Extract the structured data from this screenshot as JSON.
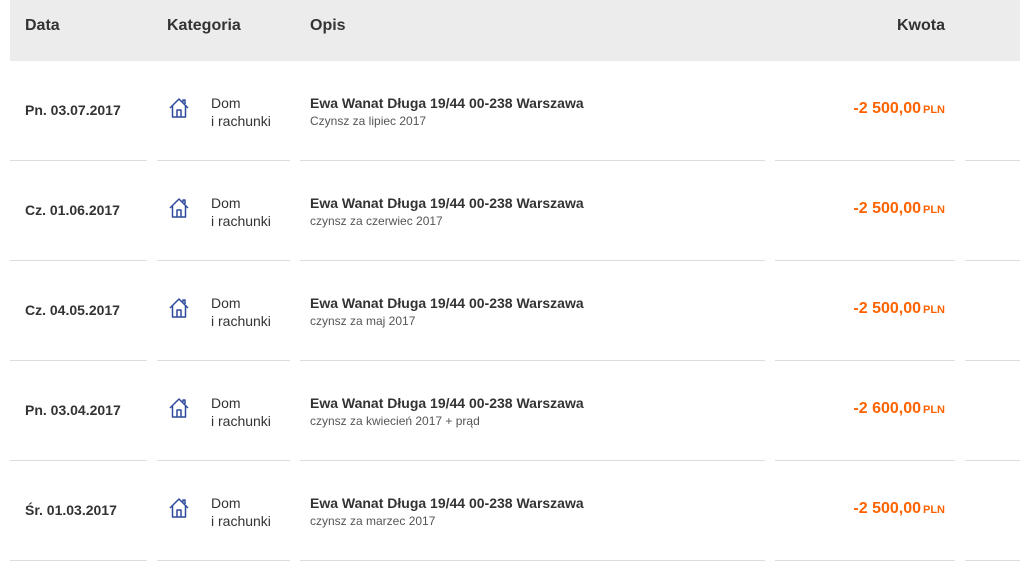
{
  "header": {
    "date": "Data",
    "category": "Kategoria",
    "description": "Opis",
    "amount": "Kwota"
  },
  "colors": {
    "accent": "#ff6200",
    "icon": "#2f4a9c",
    "header_bg": "#ececec"
  },
  "transactions": [
    {
      "date": "Pn. 03.07.2017",
      "category_icon": "house-icon",
      "category_line1": "Dom",
      "category_line2": "i rachunki",
      "title": "Ewa Wanat Długa 19/44 00-238 Warszawa",
      "subtitle": "Czynsz za lipiec 2017",
      "amount": "-2 500,00",
      "currency": "PLN"
    },
    {
      "date": "Cz. 01.06.2017",
      "category_icon": "house-icon",
      "category_line1": "Dom",
      "category_line2": "i rachunki",
      "title": "Ewa Wanat Długa 19/44 00-238 Warszawa",
      "subtitle": "czynsz za czerwiec 2017",
      "amount": "-2 500,00",
      "currency": "PLN"
    },
    {
      "date": "Cz. 04.05.2017",
      "category_icon": "house-icon",
      "category_line1": "Dom",
      "category_line2": "i rachunki",
      "title": "Ewa Wanat Długa 19/44 00-238 Warszawa",
      "subtitle": "czynsz za maj 2017",
      "amount": "-2 500,00",
      "currency": "PLN"
    },
    {
      "date": "Pn. 03.04.2017",
      "category_icon": "house-icon",
      "category_line1": "Dom",
      "category_line2": "i rachunki",
      "title": "Ewa Wanat Długa 19/44 00-238 Warszawa",
      "subtitle": "czynsz za kwiecień 2017 + prąd",
      "amount": "-2 600,00",
      "currency": "PLN"
    },
    {
      "date": "Śr. 01.03.2017",
      "category_icon": "house-icon",
      "category_line1": "Dom",
      "category_line2": "i rachunki",
      "title": "Ewa Wanat Długa 19/44 00-238 Warszawa",
      "subtitle": "czynsz za marzec 2017",
      "amount": "-2 500,00",
      "currency": "PLN"
    }
  ]
}
